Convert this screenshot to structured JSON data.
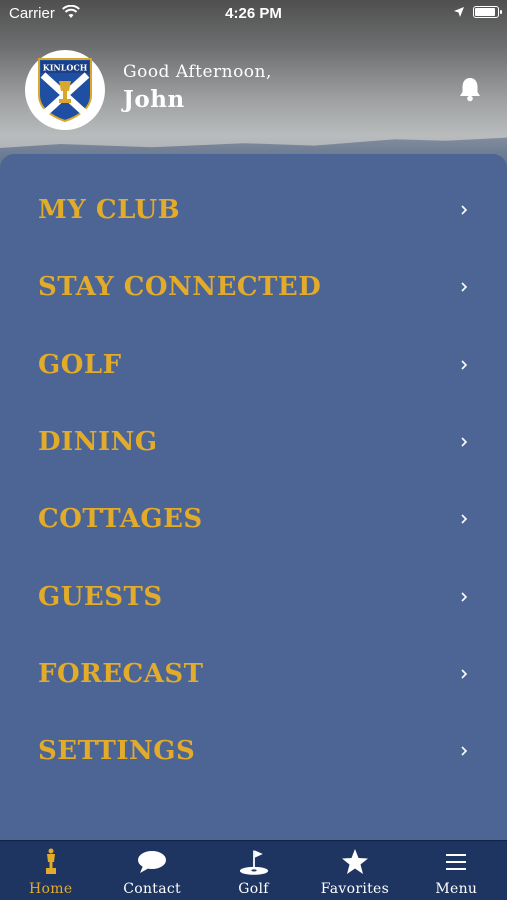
{
  "status_bar": {
    "carrier": "Carrier",
    "time": "4:26 PM"
  },
  "header": {
    "logo_text": "KINLOCH",
    "greeting": "Good Afternoon,",
    "username": "John"
  },
  "menu": {
    "items": [
      {
        "label": "MY CLUB"
      },
      {
        "label": "STAY CONNECTED"
      },
      {
        "label": "GOLF"
      },
      {
        "label": "DINING"
      },
      {
        "label": "COTTAGES"
      },
      {
        "label": "GUESTS"
      },
      {
        "label": "FORECAST"
      },
      {
        "label": "SETTINGS"
      }
    ]
  },
  "tab_bar": {
    "tabs": [
      {
        "label": "Home",
        "icon": "trophy-icon",
        "active": true
      },
      {
        "label": "Contact",
        "icon": "chat-bubble-icon",
        "active": false
      },
      {
        "label": "Golf",
        "icon": "golf-flag-icon",
        "active": false
      },
      {
        "label": "Favorites",
        "icon": "star-icon",
        "active": false
      },
      {
        "label": "Menu",
        "icon": "hamburger-icon",
        "active": false
      }
    ]
  },
  "colors": {
    "accent_gold": "#e2ab2a",
    "panel_blue": "#4d6594",
    "tab_bar_navy": "#1e3562"
  }
}
